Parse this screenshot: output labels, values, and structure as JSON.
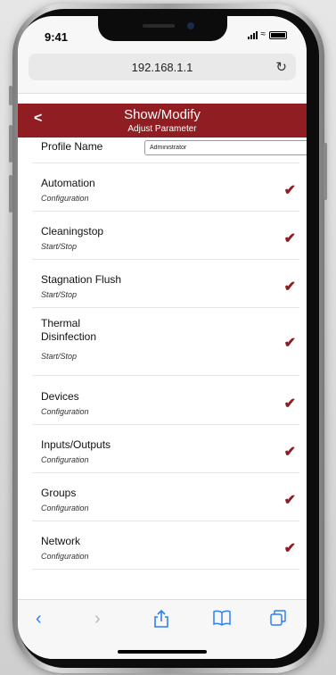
{
  "status_bar": {
    "time": "9:41"
  },
  "browser": {
    "url": "192.168.1.1",
    "reload_icon": "reload-icon"
  },
  "header": {
    "back_label": "<",
    "title": "Show/Modify",
    "subtitle": "Adjust Parameter"
  },
  "profile": {
    "label": "Profile Name",
    "value": "Administrator"
  },
  "items": [
    {
      "title": "Automation",
      "subtitle": "Configuration",
      "checked": true
    },
    {
      "title": "Cleaningstop",
      "subtitle": "Start/Stop",
      "checked": true
    },
    {
      "title": "Stagnation Flush",
      "subtitle": "Start/Stop",
      "checked": true
    },
    {
      "title": "Thermal Disinfection",
      "subtitle": "Start/Stop",
      "checked": true
    },
    {
      "title": "Devices",
      "subtitle": "Configuration",
      "checked": true
    },
    {
      "title": "Inputs/Outputs",
      "subtitle": "Configuration",
      "checked": true
    },
    {
      "title": "Groups",
      "subtitle": "Configuration",
      "checked": true
    },
    {
      "title": "Network",
      "subtitle": "Configuration",
      "checked": true
    }
  ],
  "colors": {
    "accent": "#8f1d22",
    "ios_blue": "#2d7ff9"
  },
  "toolbar_icons": [
    "back-arrow-icon",
    "forward-arrow-icon",
    "share-icon",
    "bookmarks-icon",
    "tabs-icon"
  ]
}
